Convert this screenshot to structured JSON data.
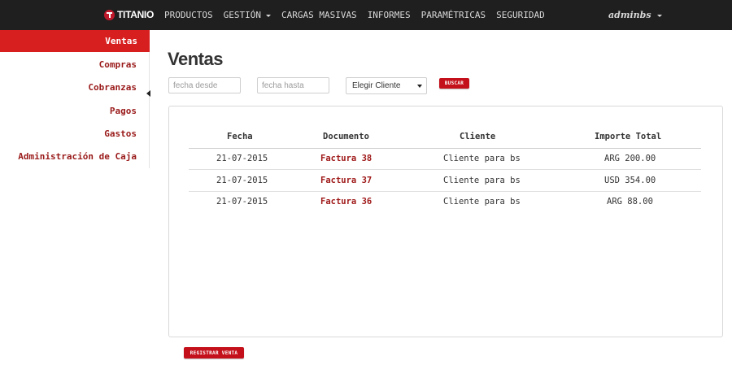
{
  "navbar": {
    "brand": "TITANIO",
    "items": [
      {
        "label": "PRODUCTOS",
        "caret": false
      },
      {
        "label": "GESTIÓN",
        "caret": true
      },
      {
        "label": "CARGAS MASIVAS",
        "caret": false
      },
      {
        "label": "INFORMES",
        "caret": false
      },
      {
        "label": "PARAMÉTRICAS",
        "caret": false
      },
      {
        "label": "SEGURIDAD",
        "caret": false
      }
    ],
    "user": "adminbs"
  },
  "sidebar": {
    "items": [
      {
        "label": "Ventas",
        "active": true
      },
      {
        "label": "Compras",
        "active": false
      },
      {
        "label": "Cobranzas",
        "active": false
      },
      {
        "label": "Pagos",
        "active": false
      },
      {
        "label": "Gastos",
        "active": false
      },
      {
        "label": "Administración de Caja",
        "active": false
      }
    ]
  },
  "main": {
    "title": "Ventas",
    "filters": {
      "date_from_placeholder": "fecha desde",
      "date_to_placeholder": "fecha hasta",
      "client_select": "Elegir Cliente",
      "search_button": "BUSCAR"
    },
    "table": {
      "headers": [
        "Fecha",
        "Documento",
        "Cliente",
        "Importe Total"
      ],
      "rows": [
        {
          "fecha": "21-07-2015",
          "documento": "Factura 38",
          "cliente": "Cliente para bs",
          "importe": "ARG 200.00"
        },
        {
          "fecha": "21-07-2015",
          "documento": "Factura 37",
          "cliente": "Cliente para bs",
          "importe": "USD 354.00"
        },
        {
          "fecha": "21-07-2015",
          "documento": "Factura 36",
          "cliente": "Cliente para bs",
          "importe": "ARG 88.00"
        }
      ]
    },
    "register_button": "REGISTRAR VENTA"
  },
  "colors": {
    "accent": "#d71f1f",
    "button": "#c4101a",
    "link": "#a01b1b",
    "navbar": "#1f1f1f"
  }
}
